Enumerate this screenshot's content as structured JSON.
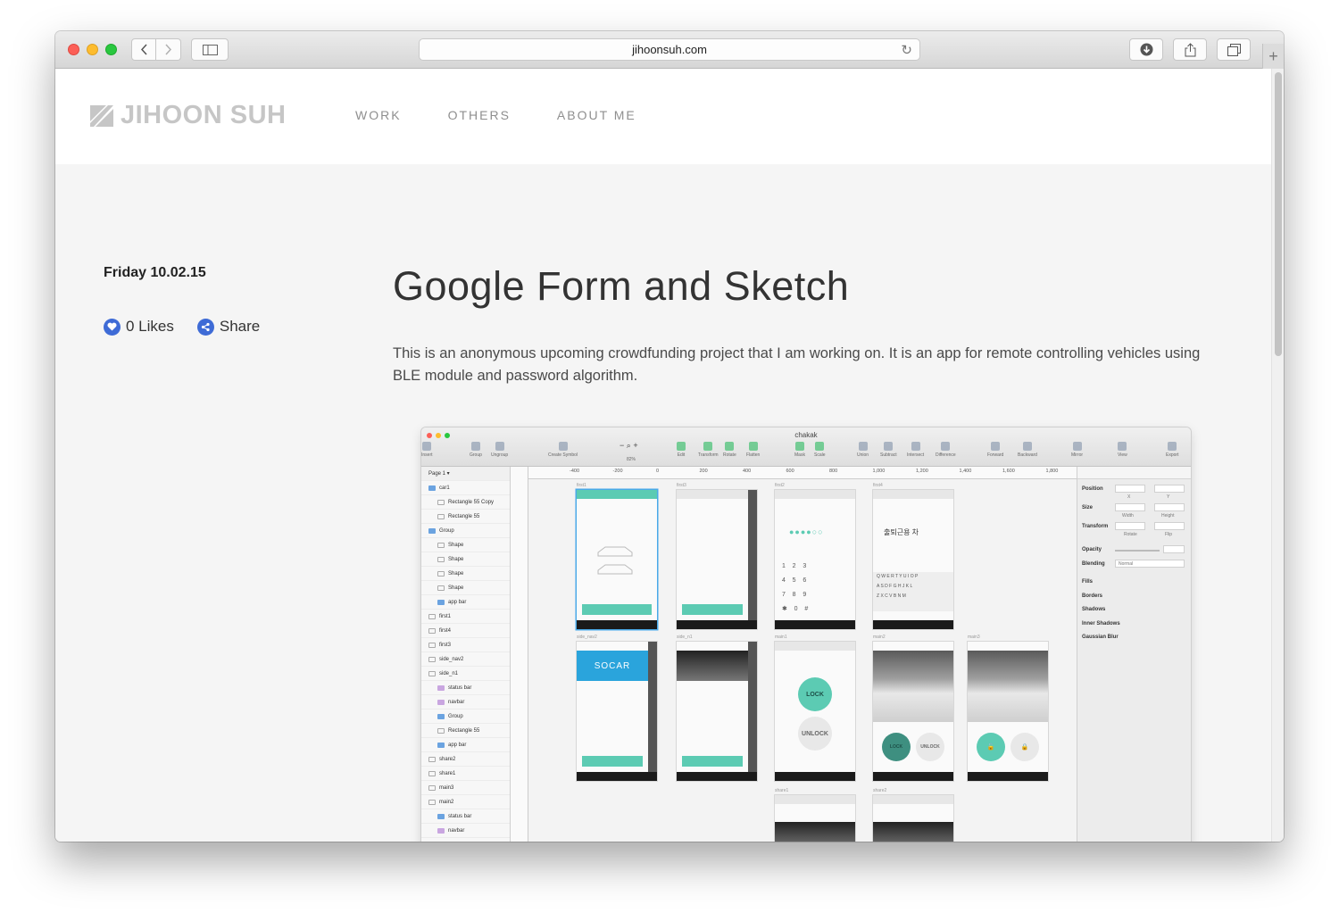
{
  "browser": {
    "url": "jihoonsuh.com"
  },
  "site": {
    "logo_text": "JIHOON SUH",
    "nav": [
      "WORK",
      "OTHERS",
      "ABOUT ME"
    ]
  },
  "post": {
    "date": "Friday 10.02.15",
    "likes_label": "0 Likes",
    "share_label": "Share",
    "title": "Google Form and Sketch",
    "body": "This is an anonymous upcoming crowdfunding project that I am working on. It is an app for remote controlling vehicles using BLE module and password algorithm."
  },
  "sketch_app": {
    "file_name": "chakak",
    "zoom": "82%",
    "page_selector": "Page 1 ▾",
    "toolbar": [
      "Insert",
      "Group",
      "Ungroup",
      "Create Symbol",
      "Edit",
      "Transform",
      "Rotate",
      "Flatten",
      "Mask",
      "Scale",
      "Union",
      "Subtract",
      "Intersect",
      "Difference",
      "Forward",
      "Backward",
      "Mirror",
      "View",
      "Export"
    ],
    "ruler": [
      "-400",
      "-200",
      "0",
      "200",
      "400",
      "600",
      "800",
      "1,000",
      "1,200",
      "1,400",
      "1,600",
      "1,800"
    ],
    "layers": [
      {
        "name": "car1",
        "type": "folder"
      },
      {
        "name": "Rectangle 55 Copy",
        "type": "rect"
      },
      {
        "name": "Rectangle 55",
        "type": "rect"
      },
      {
        "name": "Group",
        "type": "folder"
      },
      {
        "name": "Shape",
        "type": "shape"
      },
      {
        "name": "Shape",
        "type": "shape"
      },
      {
        "name": "Shape",
        "type": "shape"
      },
      {
        "name": "Shape",
        "type": "shape"
      },
      {
        "name": "app bar",
        "type": "folder"
      },
      {
        "name": "first1",
        "type": "page"
      },
      {
        "name": "first4",
        "type": "page"
      },
      {
        "name": "first3",
        "type": "page"
      },
      {
        "name": "side_nav2",
        "type": "page"
      },
      {
        "name": "side_n1",
        "type": "page"
      },
      {
        "name": "status bar",
        "type": "pink"
      },
      {
        "name": "navbar",
        "type": "pink"
      },
      {
        "name": "Group",
        "type": "folder"
      },
      {
        "name": "Rectangle 55",
        "type": "rect"
      },
      {
        "name": "app bar",
        "type": "folder"
      },
      {
        "name": "share2",
        "type": "page"
      },
      {
        "name": "share1",
        "type": "page"
      },
      {
        "name": "main3",
        "type": "page"
      },
      {
        "name": "main2",
        "type": "page"
      },
      {
        "name": "status bar",
        "type": "folder"
      },
      {
        "name": "navbar",
        "type": "pink"
      }
    ],
    "artboards": [
      "first1",
      "first3",
      "first2",
      "first4",
      "side_nav2",
      "side_n1",
      "main1",
      "main2",
      "main3",
      "share1",
      "share2"
    ],
    "lock_label": "LOCK",
    "unlock_label": "UNLOCK",
    "socar_label": "SOCAR",
    "plate_text": "출퇴근용 차",
    "inspector": [
      "Position",
      "Size",
      "Transform",
      "Opacity",
      "Blending",
      "Fills",
      "Borders",
      "Shadows",
      "Inner Shadows",
      "Gaussian Blur"
    ],
    "inspector_sub": [
      "X",
      "Y",
      "Width",
      "Height",
      "Rotate",
      "Flip"
    ],
    "blending_value": "Normal"
  },
  "colors": {
    "accent_blue": "#3e6bd6",
    "teal": "#5ccbb3",
    "logo_gray": "#c6c6c6"
  }
}
